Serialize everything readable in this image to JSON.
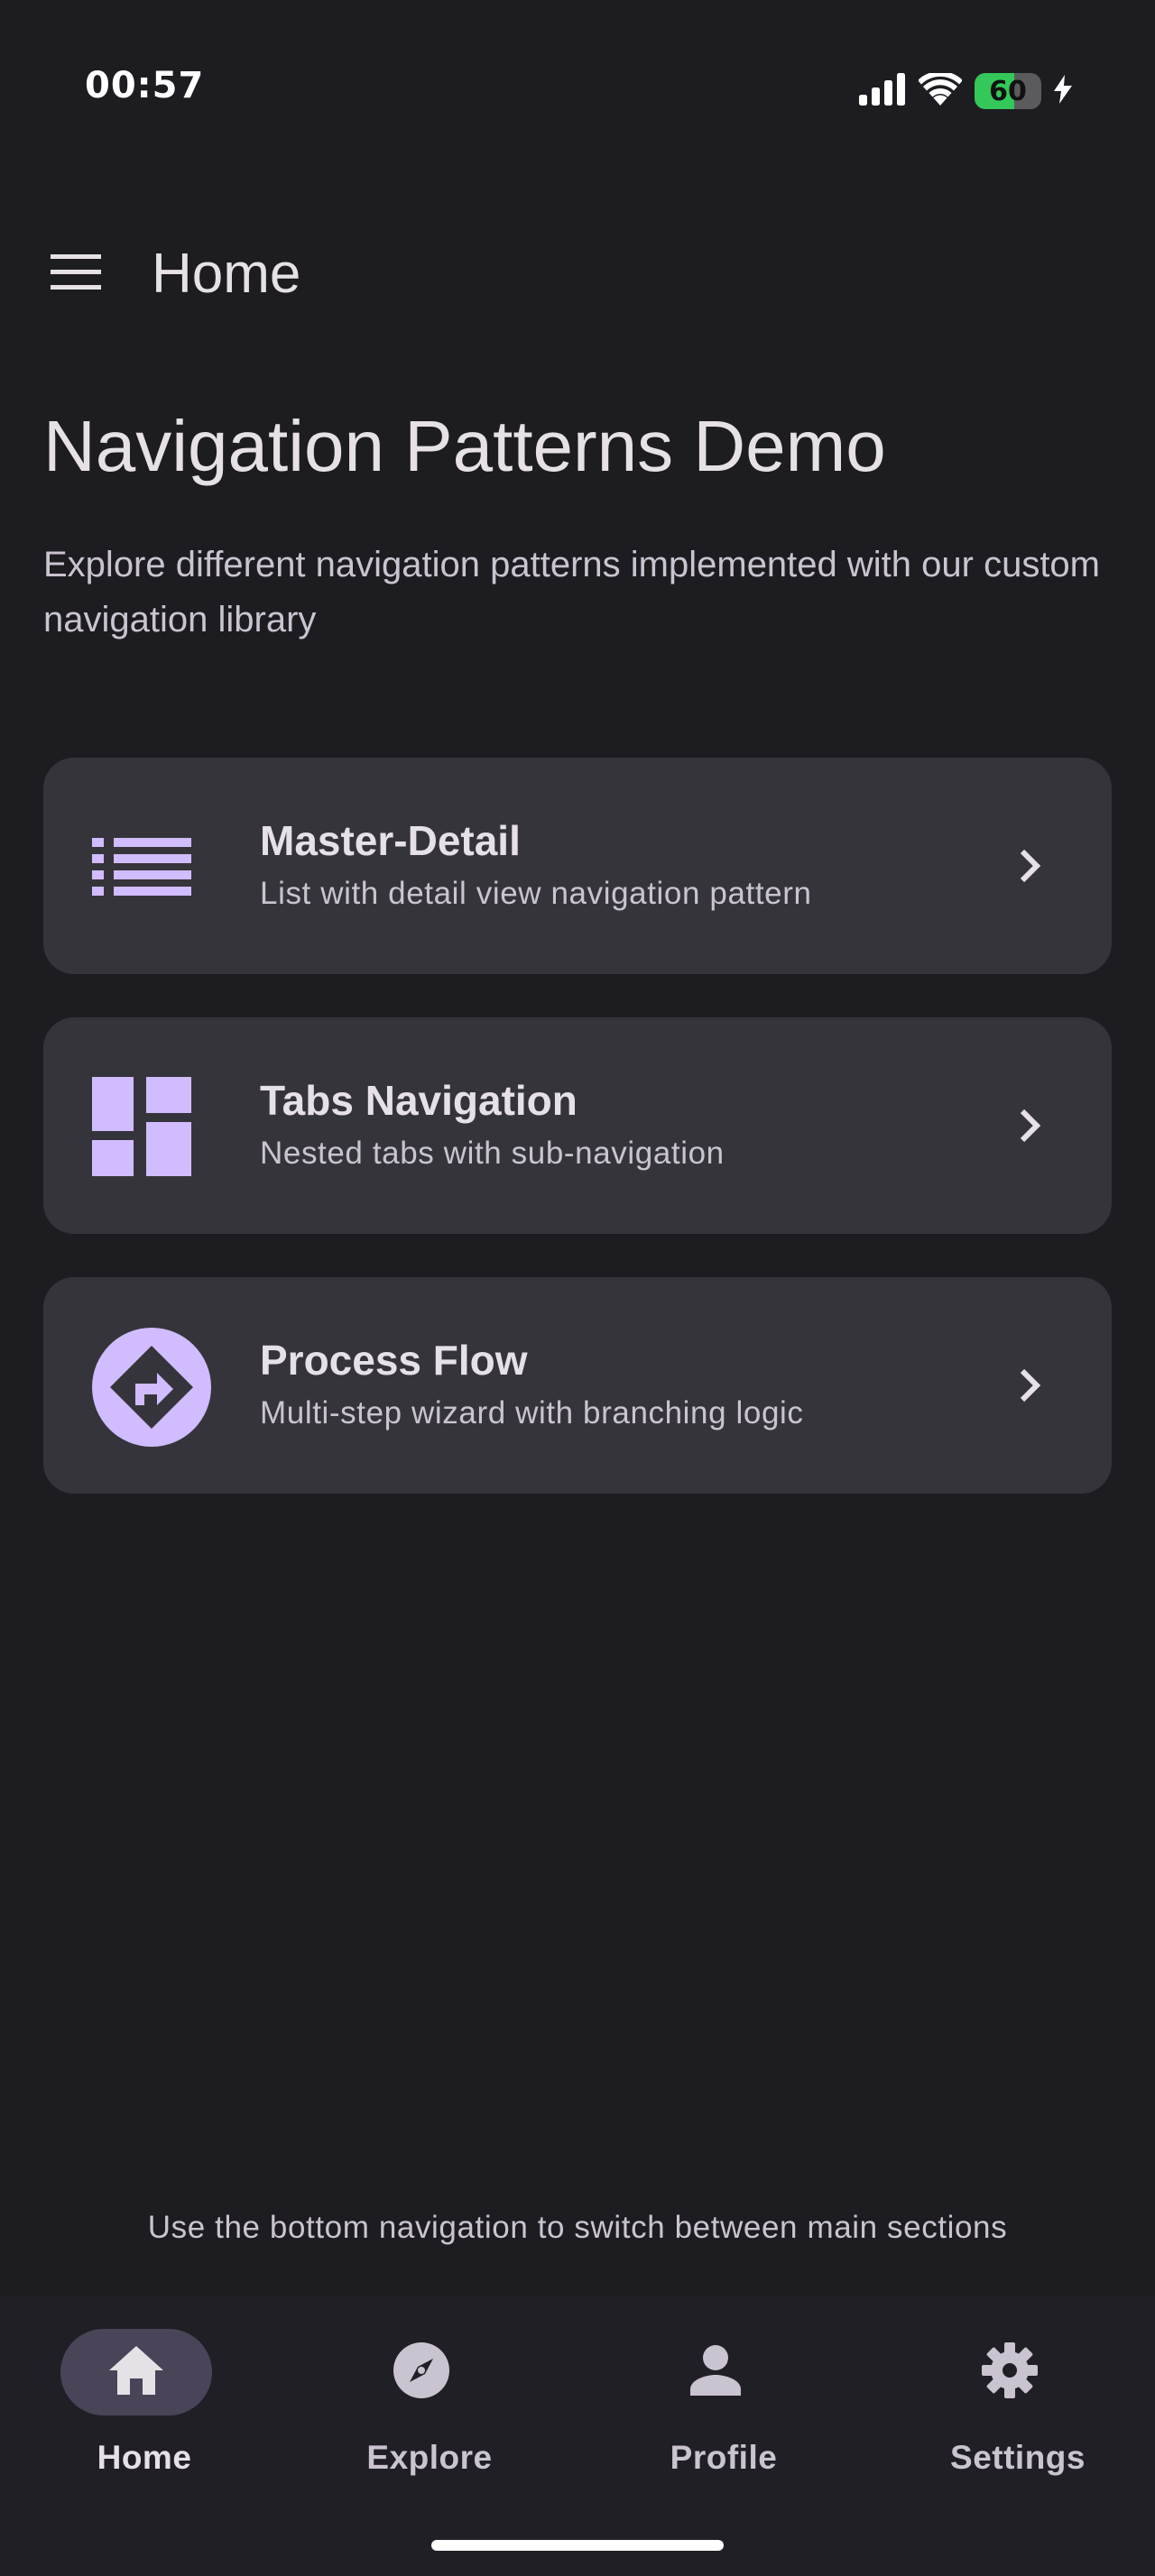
{
  "status_bar": {
    "time": "00:57",
    "battery_level": "60",
    "battery_percent": 60,
    "icons": [
      "signal-icon",
      "wifi-icon",
      "battery-icon",
      "charging-bolt-icon"
    ]
  },
  "app_bar": {
    "title": "Home",
    "menu_icon": "hamburger-menu-icon"
  },
  "page": {
    "title": "Navigation Patterns Demo",
    "subtitle": "Explore different navigation patterns implemented with our custom navigation library"
  },
  "cards": [
    {
      "title": "Master-Detail",
      "description": "List with detail view navigation pattern",
      "icon": "list-icon"
    },
    {
      "title": "Tabs Navigation",
      "description": "Nested tabs with sub-navigation",
      "icon": "dashboard-icon"
    },
    {
      "title": "Process Flow",
      "description": "Multi-step wizard with branching logic",
      "icon": "directions-icon"
    }
  ],
  "hint": "Use the bottom navigation to switch between main sections",
  "bottom_nav": {
    "items": [
      {
        "label": "Home",
        "icon": "home-icon",
        "active": true
      },
      {
        "label": "Explore",
        "icon": "compass-icon",
        "active": false
      },
      {
        "label": "Profile",
        "icon": "person-icon",
        "active": false
      },
      {
        "label": "Settings",
        "icon": "gear-icon",
        "active": false
      }
    ]
  },
  "colors": {
    "background": "#1d1c21",
    "card": "#36343b",
    "accent": "#d0bcff",
    "active_pill": "#4a4458",
    "battery_green": "#34c759"
  }
}
